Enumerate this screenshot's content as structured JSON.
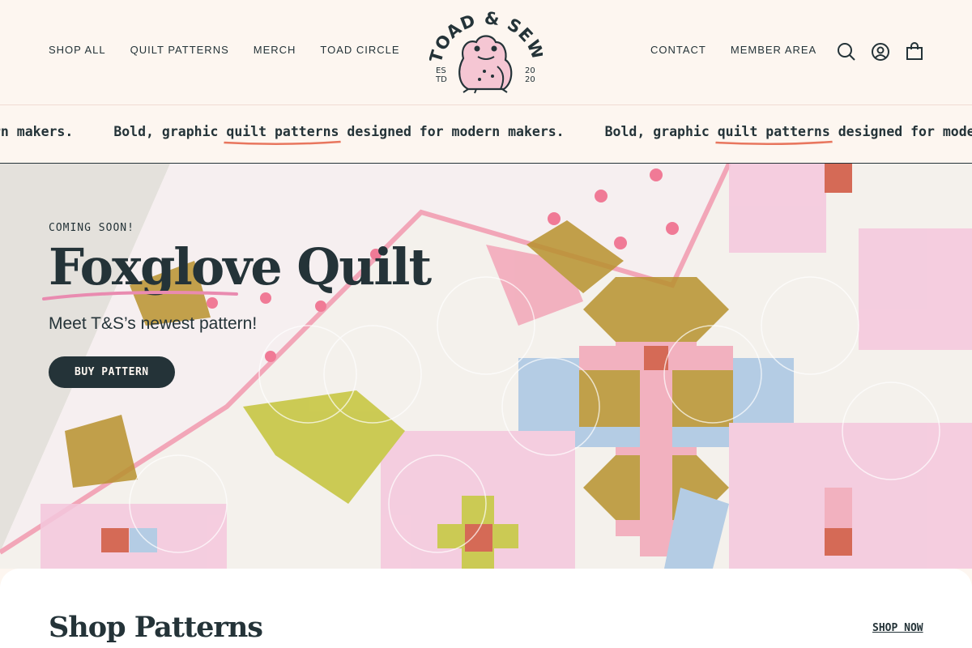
{
  "header": {
    "nav_left": [
      "SHOP ALL",
      "QUILT PATTERNS",
      "MERCH",
      "TOAD CIRCLE"
    ],
    "nav_right": [
      "CONTACT",
      "MEMBER AREA"
    ],
    "logo": {
      "name": "TOAD & SEW",
      "est_left": "ES TD",
      "est_right": "20 20"
    },
    "icons": [
      "search-icon",
      "account-icon",
      "cart-icon"
    ]
  },
  "marquee": {
    "items": [
      {
        "pre": "Bold, graphic ",
        "highlight": "quilt patterns",
        "post": " designed for modern makers."
      },
      {
        "pre": "Bold, graphic ",
        "highlight": "quilt patterns",
        "post": " designed for modern makers."
      },
      {
        "pre": "Bold, graphic ",
        "highlight": "quilt patterns",
        "post": " designed for modern makers."
      }
    ],
    "highlight_color": "#e8765e"
  },
  "hero": {
    "eyebrow": "COMING SOON!",
    "title": "Foxglove Quilt",
    "subtitle": "Meet T&S’s newest pattern!",
    "button": "BUY PATTERN",
    "underline_color": "#e98bb0"
  },
  "shop": {
    "title": "Shop Patterns",
    "link": "SHOP NOW"
  },
  "colors": {
    "ink": "#243338",
    "cream": "#fdf6f0",
    "pink": "#f2a6b8",
    "mustard": "#b8922e",
    "blue": "#a9c6e3",
    "lime": "#c4c43a",
    "red": "#d0533c"
  }
}
